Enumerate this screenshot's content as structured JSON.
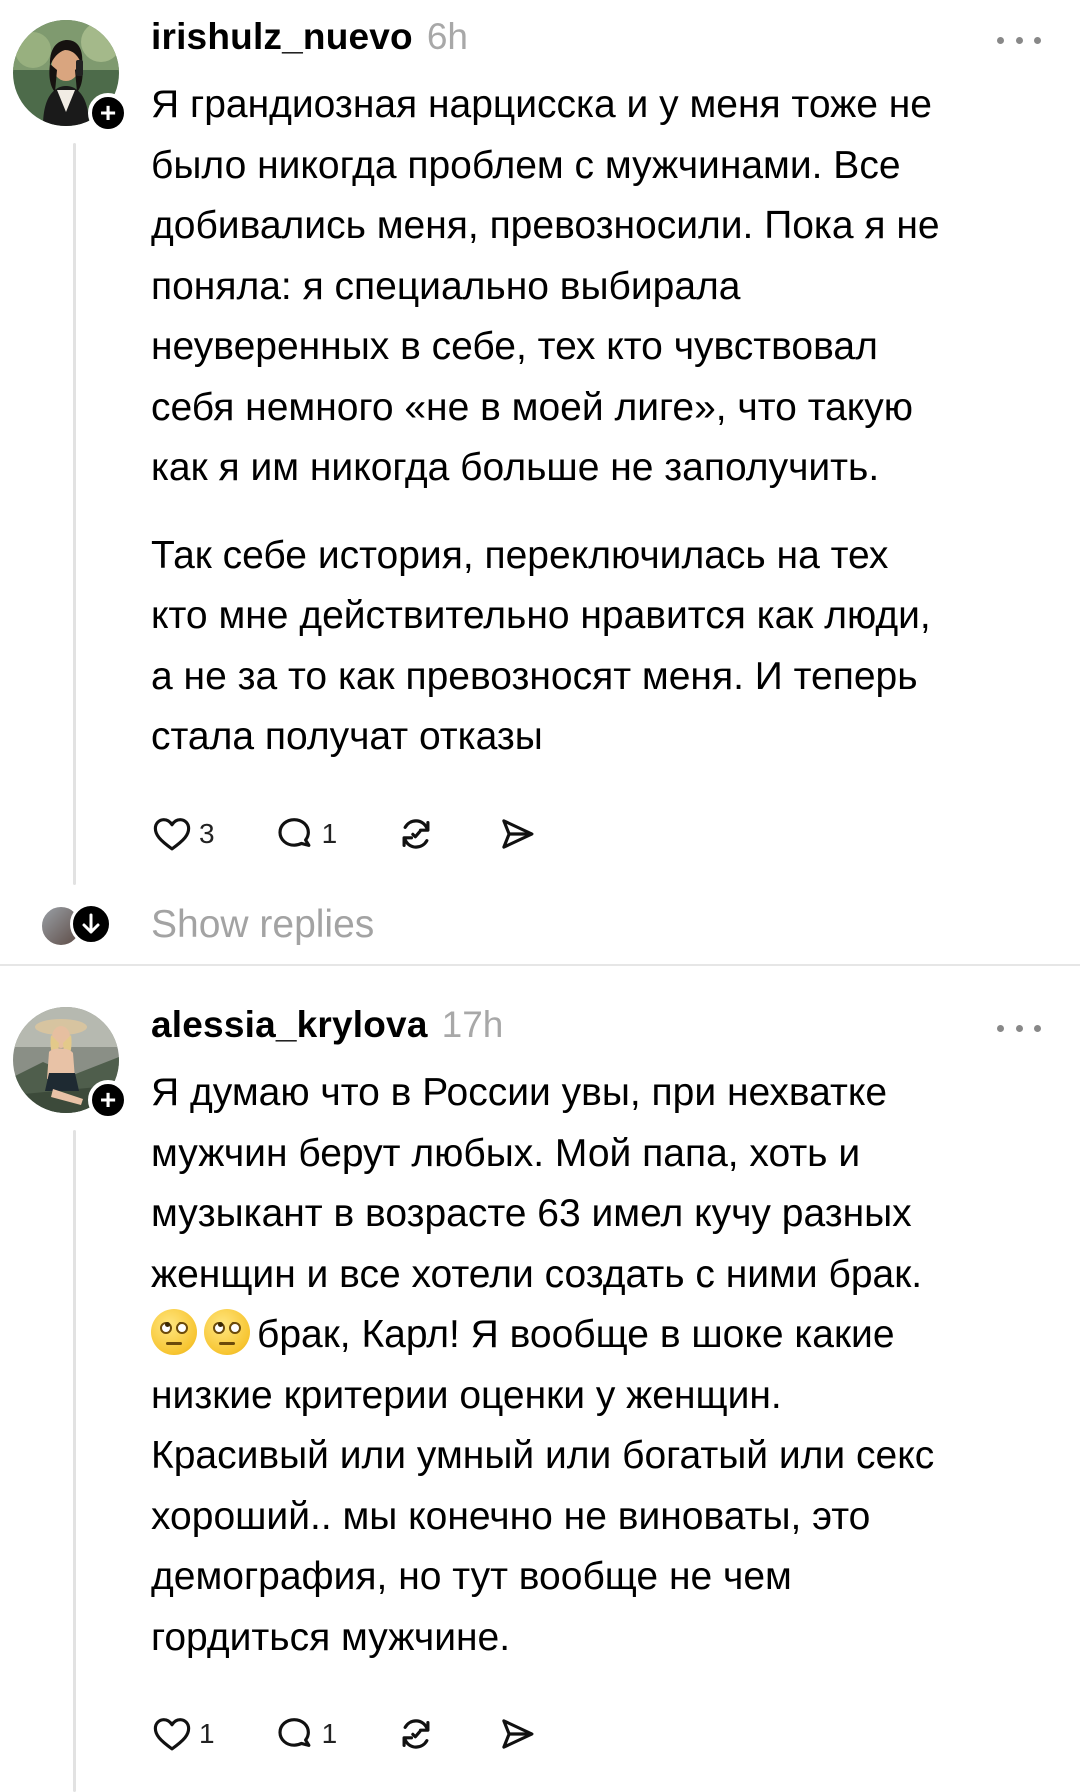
{
  "comments": [
    {
      "username": "irishulz_nuevo",
      "time": "6h",
      "paragraphs": [
        "Я грандиозная нарцисска и у меня тоже не\nбыло никогда проблем с мужчинами. Все\nдобивались меня, превозносили. Пока я не\nпоняла: я специально выбирала\nнеуверенных в себе, тех кто чувствовал\nсебя немного «не в моей лиге», что такую\nкак я им никогда больше не заполучить.",
        "Так себе история, переключилась на тех\nкто мне действительно нравится как люди,\nа не за то как превозносят меня. И теперь\nстала получат отказы"
      ],
      "likes": "3",
      "replies": "1"
    },
    {
      "username": "alessia_krylova",
      "time": "17h",
      "text_before_emoji": "Я думаю что в России увы, при нехватке\nмужчин берут любых. Мой папа, хоть и\nмузыкант в возрасте 63 имел кучу разных\nженщин и все хотели создать с ними брак.\n",
      "emoji": [
        "face-with-rolling-eyes",
        "face-with-rolling-eyes"
      ],
      "text_after_emoji": "брак, Карл! Я вообще  в шоке какие\nнизкие критерии оценки у женщин.\nКрасивый или умный или богатый или секс\nхороший.. мы конечно не виноваты, это\nдемография, но тут вообще не чем\nгордиться мужчине.",
      "likes": "1",
      "replies": "1"
    }
  ],
  "show_replies_label": "Show replies",
  "icons": {
    "follow": "plus-icon",
    "more": "more-icon",
    "like": "heart-icon",
    "reply": "comment-icon",
    "repost": "repost-icon",
    "share": "send-icon",
    "expand": "arrow-down-icon"
  }
}
